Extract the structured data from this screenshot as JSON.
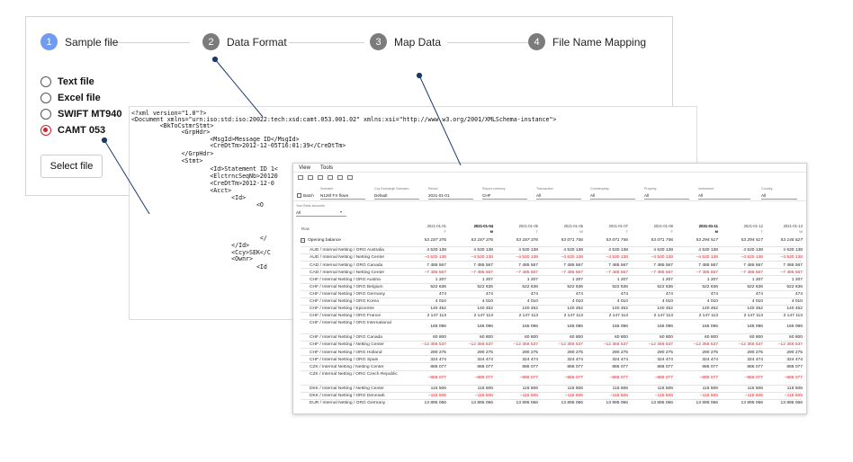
{
  "wizard": {
    "steps": [
      {
        "num": "1",
        "label": "Sample file"
      },
      {
        "num": "2",
        "label": "Data Format"
      },
      {
        "num": "3",
        "label": "Map Data"
      },
      {
        "num": "4",
        "label": "File Name Mapping"
      }
    ],
    "options": [
      {
        "label": "Text file"
      },
      {
        "label": "Excel file"
      },
      {
        "label": "SWIFT MT940"
      },
      {
        "label": "CAMT 053"
      }
    ],
    "selected_option": "CAMT 053",
    "select_file_label": "Select file"
  },
  "xml": {
    "lines": [
      "<?xml version=\"1.0\"?>",
      "<Document xmlns=\"urn:iso:std:iso:20022:tech:xsd:camt.053.001.02\" xmlns:xsi=\"http://www.w3.org/2001/XMLSchema-instance\">",
      "        <BkToCstmrStmt>",
      "              <GrpHdr>",
      "                      <MsgId>Message ID</MsgId>",
      "                      <CreDtTm>2012-12-05T16:01:39</CreDtTm>",
      "              </GrpHdr>",
      "              <Stmt>",
      "                      <Id>Statement ID 1<",
      "                      <ElctrncSeqNb>20120",
      "                      <CreDtTm>2012-12-0",
      "                      <Acct>",
      "                            <Id>",
      "                                   <O",
      "",
      "",
      "                                    </",
      "                            </Id>",
      "                            <Ccy>SEK</C",
      "                            <Ownr>",
      "                                   <Id"
    ]
  },
  "table_panel": {
    "menu": [
      "View",
      "Tools"
    ],
    "toolbar_icons": [
      "folder-icon",
      "link-icon",
      "document-icon",
      "grid-icon",
      "chart-icon",
      "line-chart-icon"
    ],
    "filters": [
      {
        "label": "Scenario",
        "value": "N126f FX flows"
      },
      {
        "label": "Ccy Exchange Scenario",
        "value": "Default"
      },
      {
        "label": "Period",
        "value": "2021-01-01"
      },
      {
        "label": "Report currency",
        "value": "CHF"
      },
      {
        "label": "Transaction",
        "value": "All"
      },
      {
        "label": "Counterparty",
        "value": "All"
      },
      {
        "label": "Property",
        "value": "All"
      },
      {
        "label": "Instrument",
        "value": "All"
      },
      {
        "label": "Country",
        "value": "All"
      }
    ],
    "batch_label": "Batch",
    "bank_accounts_label": "Your Bank accounts",
    "bank_accounts_value": "All",
    "row_header": "Row",
    "columns": [
      {
        "date": "2021-01-01",
        "day": "F",
        "bold": false
      },
      {
        "date": "2021-01-04",
        "day": "M",
        "bold": true
      },
      {
        "date": "2021-01-05",
        "day": "T",
        "bold": false
      },
      {
        "date": "2021-01-06",
        "day": "W",
        "bold": false
      },
      {
        "date": "2021-01-07",
        "day": "T",
        "bold": false
      },
      {
        "date": "2021-01-08",
        "day": "F",
        "bold": false
      },
      {
        "date": "2021-01-11",
        "day": "M",
        "bold": true
      },
      {
        "date": "2021-01-12",
        "day": "T",
        "bold": false
      },
      {
        "date": "2021-01-13",
        "day": "W",
        "bold": false
      }
    ],
    "opening_balance": {
      "label": "Opening balance",
      "values": [
        "53 187 376",
        "53 187 376",
        "53 187 376",
        "53 071 746",
        "53 071 746",
        "53 071 746",
        "53 294 517",
        "53 294 517",
        "53 146 627"
      ]
    },
    "rows": [
      {
        "label": "AUD / Internal Netting / ORG Australia",
        "values": [
          "4 530 138",
          "4 530 138",
          "4 530 138",
          "4 530 138",
          "4 530 138",
          "4 530 138",
          "4 530 138",
          "4 530 138",
          "4 530 138"
        ],
        "neg": false
      },
      {
        "label": "AUD / Internal Netting / Netting Center",
        "values": [
          "–4 530 138",
          "–4 530 138",
          "–4 530 138",
          "–4 530 138",
          "–4 530 138",
          "–4 530 138",
          "–4 530 138",
          "–4 530 138",
          "–4 530 138"
        ],
        "neg": true
      },
      {
        "label": "CAD / Internal Netting / ORG Canada",
        "values": [
          "7 485 567",
          "7 485 567",
          "7 485 567",
          "7 485 567",
          "7 485 567",
          "7 485 567",
          "7 485 567",
          "7 485 567",
          "7 485 567"
        ],
        "neg": false
      },
      {
        "label": "CAD / Internal Netting / Netting Center",
        "values": [
          "–7 485 567",
          "–7 485 567",
          "–7 485 567",
          "–7 485 567",
          "–7 485 567",
          "–7 485 567",
          "–7 485 567",
          "–7 485 567",
          "–7 485 567"
        ],
        "neg": true
      },
      {
        "label": "CHF / Internal Netting / ORG Austria",
        "values": [
          "1 207",
          "1 207",
          "1 207",
          "1 207",
          "1 207",
          "1 207",
          "1 207",
          "1 207",
          "1 207"
        ],
        "neg": false
      },
      {
        "label": "CHF / Internal Netting / ORG Belgium",
        "values": [
          "522 636",
          "522 636",
          "522 636",
          "522 636",
          "522 636",
          "522 636",
          "522 636",
          "522 636",
          "522 636"
        ],
        "neg": false
      },
      {
        "label": "CHF / Internal Netting / ORG Germany",
        "values": [
          "474",
          "474",
          "474",
          "474",
          "474",
          "474",
          "474",
          "474",
          "474"
        ],
        "neg": false
      },
      {
        "label": "CHF / Internal Netting / ORG Korea",
        "values": [
          "4 010",
          "4 010",
          "4 010",
          "4 010",
          "4 010",
          "4 010",
          "4 010",
          "4 010",
          "4 010"
        ],
        "neg": false
      },
      {
        "label": "CHF / Internal Netting / Epicentre",
        "values": [
          "140 452",
          "140 452",
          "140 452",
          "140 452",
          "140 452",
          "140 452",
          "140 452",
          "140 452",
          "140 452"
        ],
        "neg": false
      },
      {
        "label": "CHF / Internal Netting / ORG France",
        "values": [
          "2 147 113",
          "2 147 113",
          "2 147 113",
          "2 147 113",
          "2 147 113",
          "2 147 113",
          "2 147 113",
          "2 147 113",
          "2 147 113"
        ],
        "neg": false
      },
      {
        "label": "CHF / Internal Netting / ORG International",
        "values": [
          "165 096",
          "165 096",
          "165 096",
          "165 096",
          "165 096",
          "165 096",
          "165 096",
          "165 096",
          "165 096"
        ],
        "neg": false,
        "tall": true
      },
      {
        "label": "CHF / Internal Netting / ORG Canada",
        "values": [
          "60 800",
          "60 800",
          "60 800",
          "60 800",
          "60 800",
          "60 800",
          "60 800",
          "60 800",
          "60 800"
        ],
        "neg": false
      },
      {
        "label": "CHF / Internal Netting / Netting Center",
        "values": [
          "–12 356 537",
          "–12 356 537",
          "–12 356 537",
          "–12 356 537",
          "–12 356 537",
          "–12 356 537",
          "–12 356 537",
          "–12 356 537",
          "–12 356 537"
        ],
        "neg": true
      },
      {
        "label": "CHF / Internal Netting / ORG Holland",
        "values": [
          "290 275",
          "290 275",
          "290 275",
          "290 275",
          "290 275",
          "290 275",
          "290 275",
          "290 275",
          "290 275"
        ],
        "neg": false
      },
      {
        "label": "CHF / Internal Netting / ORG Spain",
        "values": [
          "324 474",
          "324 474",
          "324 474",
          "324 474",
          "324 474",
          "324 474",
          "324 474",
          "324 474",
          "324 474"
        ],
        "neg": false
      },
      {
        "label": "CZK / Internal Netting / Netting Center",
        "values": [
          "886 077",
          "886 077",
          "886 077",
          "886 077",
          "886 077",
          "886 077",
          "886 077",
          "886 077",
          "886 077"
        ],
        "neg": false
      },
      {
        "label": "CZK / Internal Netting / ORG Czech Republic",
        "values": [
          "–886 077",
          "–886 077",
          "–886 077",
          "–886 077",
          "–886 077",
          "–886 077",
          "–886 077",
          "–886 077",
          "–886 077"
        ],
        "neg": true,
        "tall": true
      },
      {
        "label": "DKK / Internal Netting / Netting Center",
        "values": [
          "115 506",
          "115 506",
          "115 506",
          "115 506",
          "115 506",
          "115 506",
          "115 506",
          "115 506",
          "115 506"
        ],
        "neg": false
      },
      {
        "label": "DKK / Internal Netting / ORG Denmark",
        "values": [
          "–115 506",
          "–115 506",
          "–115 506",
          "–115 506",
          "–115 506",
          "–115 506",
          "–115 506",
          "–115 506",
          "–115 506"
        ],
        "neg": true
      },
      {
        "label": "EUR / Internal Netting / ORG Germany",
        "values": [
          "13 895 066",
          "13 895 066",
          "13 895 066",
          "13 895 066",
          "13 895 066",
          "13 895 066",
          "13 895 066",
          "13 895 066",
          "13 895 066"
        ],
        "neg": false
      }
    ]
  },
  "colors": {
    "active_step": "#6f9bf0",
    "inactive_step": "#7b7b7b",
    "selected_radio": "#c9252b",
    "negative_value": "#d8232a",
    "pointer": "#1a3a6e"
  }
}
